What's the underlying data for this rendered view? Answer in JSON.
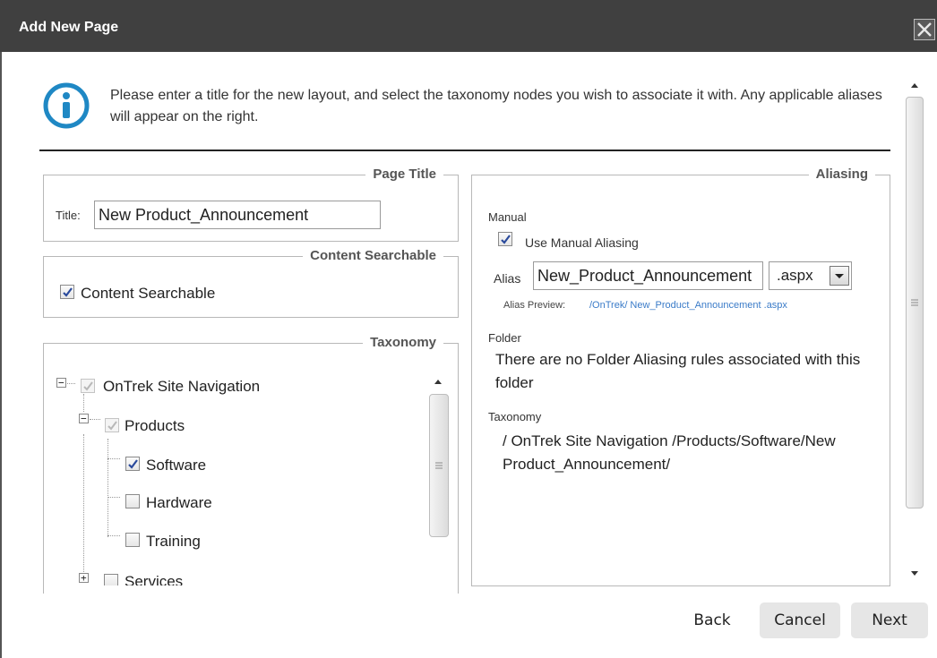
{
  "dialog": {
    "title": "Add New Page"
  },
  "intro": "Please enter a title for the new layout, and select the taxonomy nodes you wish to associate it with. Any applicable aliases will appear on the right.",
  "page_title": {
    "legend": "Page Title",
    "label": "Title:",
    "value": "New Product_Announcement"
  },
  "searchable": {
    "legend": "Content Searchable",
    "label": "Content Searchable",
    "checked": true
  },
  "taxonomy": {
    "legend": "Taxonomy",
    "root": "OnTrek Site Navigation",
    "products": "Products",
    "children": [
      "Software",
      "Hardware",
      "Training"
    ],
    "services": "Services"
  },
  "aliasing": {
    "legend": "Aliasing",
    "manual_label": "Manual",
    "use_manual": "Use Manual Aliasing",
    "alias_label": "Alias",
    "alias_value": "New_Product_Announcement",
    "extension": ".aspx",
    "preview_label": "Alias Preview:",
    "preview_value": "/OnTrek/ New_Product_Announcement .aspx",
    "folder_label": "Folder",
    "folder_text": "There are no Folder Aliasing rules associated with this folder",
    "taxonomy_label": "Taxonomy",
    "taxonomy_path": "/ OnTrek Site Navigation /Products/Software/New Product_Announcement/"
  },
  "buttons": {
    "back": "Back",
    "cancel": "Cancel",
    "next": "Next"
  },
  "colors": {
    "titlebar": "#404040",
    "info_icon": "#1f88c4",
    "link": "#3a7bc8"
  }
}
